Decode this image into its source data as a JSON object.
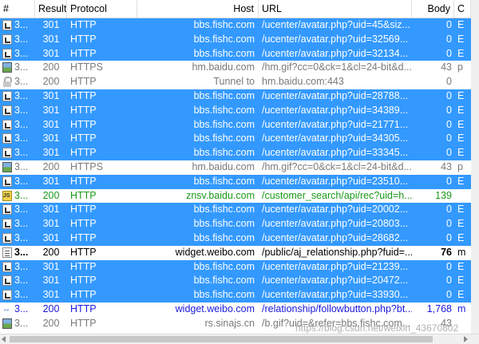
{
  "columns": {
    "num": "#",
    "result": "Result",
    "protocol": "Protocol",
    "host": "Host",
    "url": "URL",
    "body": "Body",
    "cache": "C"
  },
  "rows": [
    {
      "icon": "redirect-icon",
      "style": "sel",
      "num": "3...",
      "result": "301",
      "protocol": "HTTP",
      "host": "bbs.fishc.com",
      "url": "/ucenter/avatar.php?uid=45&siz...",
      "body": "0",
      "cache": "E"
    },
    {
      "icon": "redirect-icon",
      "style": "sel",
      "num": "3...",
      "result": "301",
      "protocol": "HTTP",
      "host": "bbs.fishc.com",
      "url": "/ucenter/avatar.php?uid=32569...",
      "body": "0",
      "cache": "E"
    },
    {
      "icon": "redirect-icon",
      "style": "sel",
      "num": "3...",
      "result": "301",
      "protocol": "HTTP",
      "host": "bbs.fishc.com",
      "url": "/ucenter/avatar.php?uid=32134...",
      "body": "0",
      "cache": "E"
    },
    {
      "icon": "image-icon",
      "style": "gray",
      "num": "3...",
      "result": "200",
      "protocol": "HTTPS",
      "host": "hm.baidu.com",
      "url": "/hm.gif?cc=0&ck=1&cl=24-bit&d...",
      "body": "43",
      "cache": "p"
    },
    {
      "icon": "lock-icon",
      "style": "gray",
      "num": "3...",
      "result": "200",
      "protocol": "HTTP",
      "host": "Tunnel to",
      "url": "hm.baidu.com:443",
      "body": "0",
      "cache": ""
    },
    {
      "icon": "redirect-icon",
      "style": "sel",
      "num": "3...",
      "result": "301",
      "protocol": "HTTP",
      "host": "bbs.fishc.com",
      "url": "/ucenter/avatar.php?uid=28788...",
      "body": "0",
      "cache": "E"
    },
    {
      "icon": "redirect-icon",
      "style": "sel",
      "num": "3...",
      "result": "301",
      "protocol": "HTTP",
      "host": "bbs.fishc.com",
      "url": "/ucenter/avatar.php?uid=34389...",
      "body": "0",
      "cache": "E"
    },
    {
      "icon": "redirect-icon",
      "style": "sel",
      "num": "3...",
      "result": "301",
      "protocol": "HTTP",
      "host": "bbs.fishc.com",
      "url": "/ucenter/avatar.php?uid=21771...",
      "body": "0",
      "cache": "E"
    },
    {
      "icon": "redirect-icon",
      "style": "sel",
      "num": "3...",
      "result": "301",
      "protocol": "HTTP",
      "host": "bbs.fishc.com",
      "url": "/ucenter/avatar.php?uid=34305...",
      "body": "0",
      "cache": "E"
    },
    {
      "icon": "redirect-icon",
      "style": "sel",
      "num": "3...",
      "result": "301",
      "protocol": "HTTP",
      "host": "bbs.fishc.com",
      "url": "/ucenter/avatar.php?uid=33345...",
      "body": "0",
      "cache": "E"
    },
    {
      "icon": "image-icon",
      "style": "gray",
      "num": "3...",
      "result": "200",
      "protocol": "HTTPS",
      "host": "hm.baidu.com",
      "url": "/hm.gif?cc=0&ck=1&cl=24-bit&d...",
      "body": "43",
      "cache": "p"
    },
    {
      "icon": "redirect-icon",
      "style": "sel",
      "num": "3...",
      "result": "301",
      "protocol": "HTTP",
      "host": "bbs.fishc.com",
      "url": "/ucenter/avatar.php?uid=23510...",
      "body": "0",
      "cache": "E"
    },
    {
      "icon": "js-icon",
      "style": "green",
      "num": "3...",
      "result": "200",
      "protocol": "HTTP",
      "host": "znsv.baidu.com",
      "url": "/customer_search/api/rec?uid=h...",
      "body": "139",
      "cache": ""
    },
    {
      "icon": "redirect-icon",
      "style": "sel",
      "num": "3...",
      "result": "301",
      "protocol": "HTTP",
      "host": "bbs.fishc.com",
      "url": "/ucenter/avatar.php?uid=20002...",
      "body": "0",
      "cache": "E"
    },
    {
      "icon": "redirect-icon",
      "style": "sel",
      "num": "3...",
      "result": "301",
      "protocol": "HTTP",
      "host": "bbs.fishc.com",
      "url": "/ucenter/avatar.php?uid=20803...",
      "body": "0",
      "cache": "E"
    },
    {
      "icon": "redirect-icon",
      "style": "sel",
      "num": "3...",
      "result": "301",
      "protocol": "HTTP",
      "host": "bbs.fishc.com",
      "url": "/ucenter/avatar.php?uid=28682...",
      "body": "0",
      "cache": "E"
    },
    {
      "icon": "document-icon",
      "style": "black",
      "num": "3...",
      "result": "200",
      "protocol": "HTTP",
      "host": "widget.weibo.com",
      "url": "/public/aj_relationship.php?fuid=...",
      "body": "76",
      "cache": "m"
    },
    {
      "icon": "redirect-icon",
      "style": "sel",
      "num": "3...",
      "result": "301",
      "protocol": "HTTP",
      "host": "bbs.fishc.com",
      "url": "/ucenter/avatar.php?uid=21239...",
      "body": "0",
      "cache": "E"
    },
    {
      "icon": "redirect-icon",
      "style": "sel",
      "num": "3...",
      "result": "301",
      "protocol": "HTTP",
      "host": "bbs.fishc.com",
      "url": "/ucenter/avatar.php?uid=20472...",
      "body": "0",
      "cache": "E"
    },
    {
      "icon": "redirect-icon",
      "style": "sel",
      "num": "3...",
      "result": "301",
      "protocol": "HTTP",
      "host": "bbs.fishc.com",
      "url": "/ucenter/avatar.php?uid=33930...",
      "body": "0",
      "cache": "E"
    },
    {
      "icon": "json-icon",
      "style": "blue",
      "num": "3...",
      "result": "200",
      "protocol": "HTTP",
      "host": "widget.weibo.com",
      "url": "/relationship/followbutton.php?bt...",
      "body": "1,768",
      "cache": "m"
    },
    {
      "icon": "image-icon",
      "style": "gray",
      "num": "3...",
      "result": "200",
      "protocol": "HTTP",
      "host": "rs.sinajs.cn",
      "url": "/b.gif?uid=&refer=bbs.fishc.com...",
      "body": "43",
      "cache": ""
    }
  ],
  "watermark": "https://blog.csdn.net/weixin_43670802"
}
